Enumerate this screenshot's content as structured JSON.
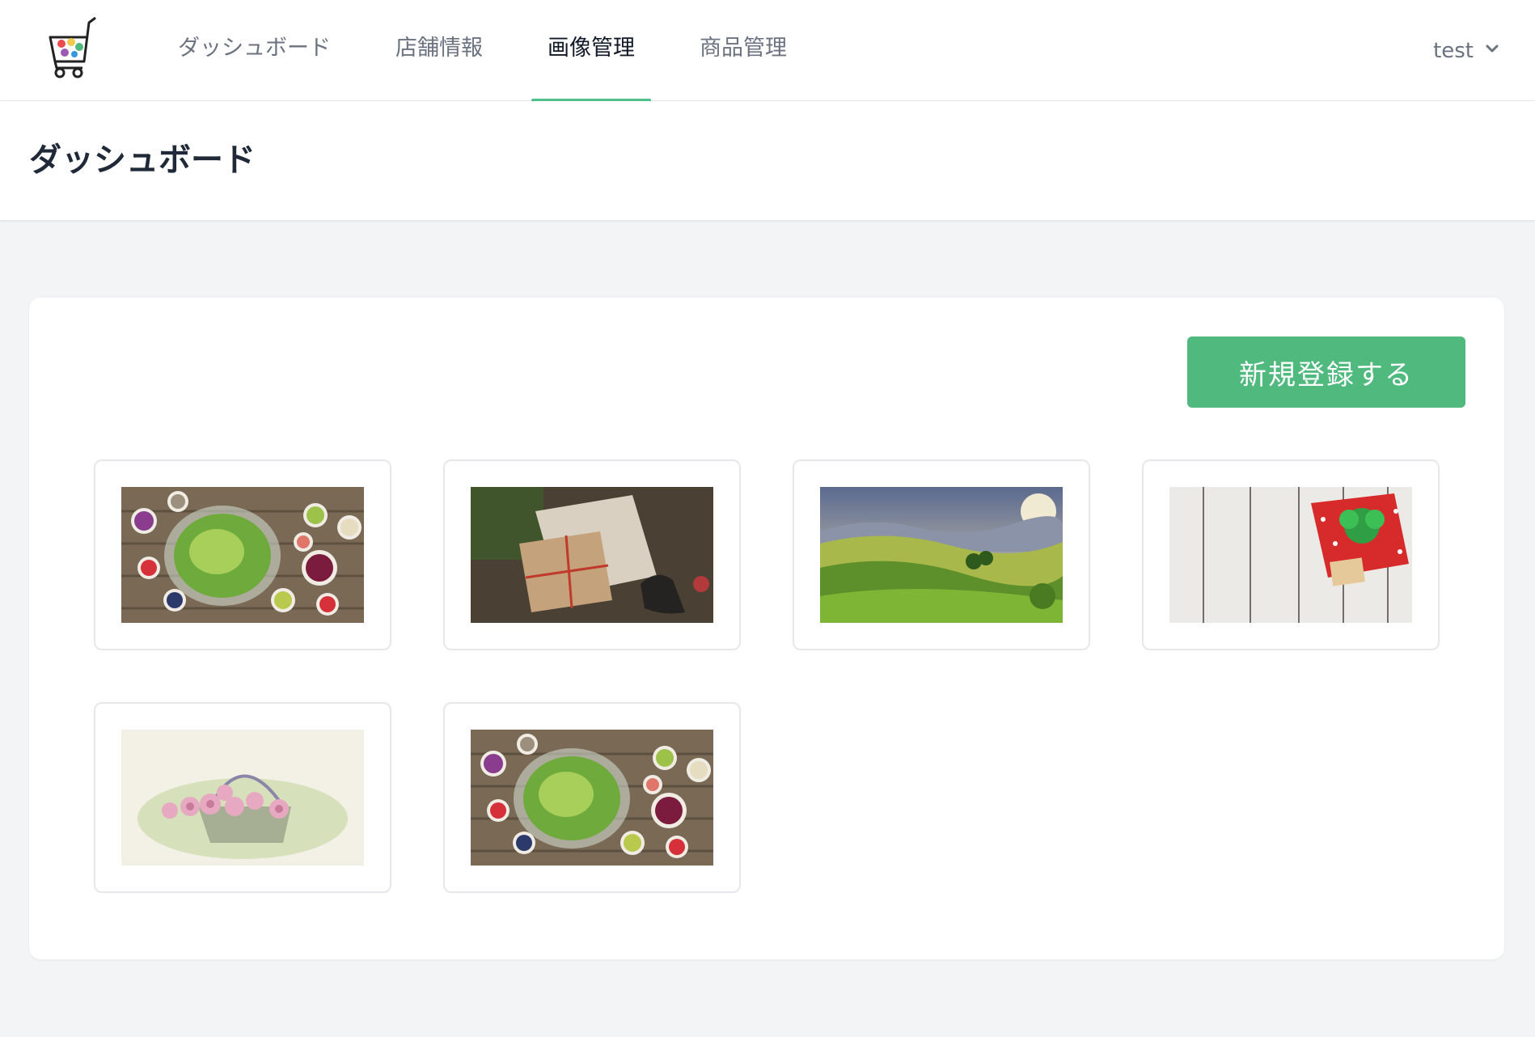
{
  "app": {
    "logo_icon": "shopping-cart-icon"
  },
  "nav": {
    "items": [
      {
        "label": "ダッシュボード",
        "active": false
      },
      {
        "label": "店舗情報",
        "active": false
      },
      {
        "label": "画像管理",
        "active": true
      },
      {
        "label": "商品管理",
        "active": false
      }
    ],
    "accent_color": "#4fc08a"
  },
  "user": {
    "name": "test",
    "menu_icon": "chevron-down-icon"
  },
  "page": {
    "title": "ダッシュボード"
  },
  "actions": {
    "new_label": "新規登録する",
    "button_color": "#4fb97e"
  },
  "images": [
    {
      "subject": "salad-bowls"
    },
    {
      "subject": "wrapped-gifts-scissors"
    },
    {
      "subject": "green-hills-landscape"
    },
    {
      "subject": "christmas-gift-on-white-wood"
    },
    {
      "subject": "rose-basket-watercolor"
    },
    {
      "subject": "salad-bowls"
    }
  ]
}
